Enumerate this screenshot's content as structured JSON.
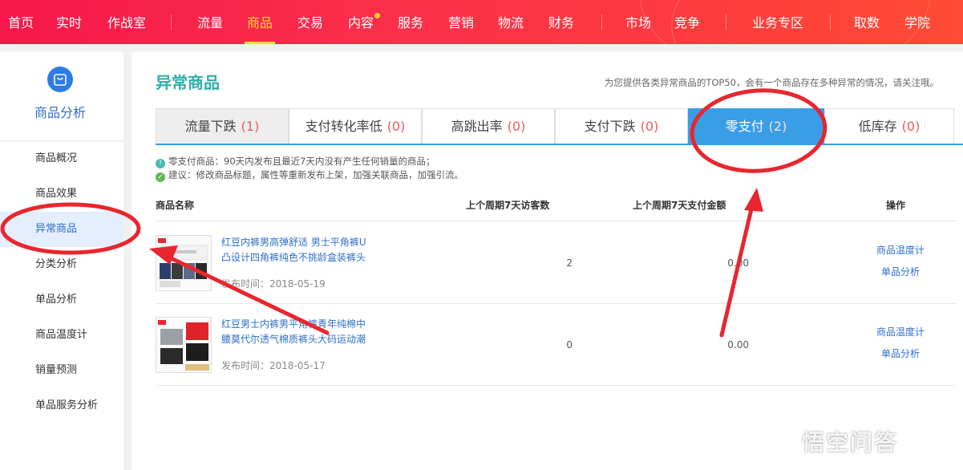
{
  "topnav": {
    "items": [
      "首页",
      "实时",
      "作战室",
      "流量",
      "商品",
      "交易",
      "内容",
      "服务",
      "营销",
      "物流",
      "财务",
      "市场",
      "竞争",
      "业务专区",
      "取数",
      "学院"
    ],
    "active": "商品",
    "accent": "#ffdf3a",
    "background": "#f5184a"
  },
  "sidebar": {
    "icon": "shopping-bag-icon",
    "title": "商品分析",
    "items": [
      "商品概况",
      "商品效果",
      "异常商品",
      "分类分析",
      "单品分析",
      "商品温度计",
      "销量预测",
      "单品服务分析"
    ],
    "active": "异常商品"
  },
  "main": {
    "title": "异常商品",
    "note": "为您提供各类异常商品的TOP50，会有一个商品存在多种异常的情况，请关注哦。",
    "tabs": [
      {
        "label": "流量下跌",
        "count": "(1)"
      },
      {
        "label": "支付转化率低",
        "count": "(0)"
      },
      {
        "label": "高跳出率",
        "count": "(0)"
      },
      {
        "label": "支付下跌",
        "count": "(0)"
      },
      {
        "label": "零支付",
        "count": "(2)"
      },
      {
        "label": "低库存",
        "count": "(0)"
      }
    ],
    "active_tab": "零支付",
    "tip_info": "零支付商品：90天内发布且最近7天内没有产生任何销量的商品；",
    "tip_suggest": "建议：修改商品标题，属性等重新发布上架，加强关联商品，加强引流。",
    "table": {
      "headers": [
        "商品名称",
        "上个周期7天访客数",
        "上个周期7天支付金额",
        "操作"
      ],
      "rows": [
        {
          "name": "红豆内裤男高弹舒适 男士平角裤U凸设计四角裤纯色不挑龄盒装裤头",
          "date": "发布时间：2018-05-19",
          "visitors": "2",
          "amount": "0.00",
          "actions": [
            "商品温度计",
            "单品分析"
          ]
        },
        {
          "name": "红豆男士内裤男平角裤青年纯棉中腰莫代尔透气棉质裤头大码运动潮",
          "date": "发布时间：2018-05-17",
          "visitors": "0",
          "amount": "0.00",
          "actions": [
            "商品温度计",
            "单品分析"
          ]
        }
      ]
    }
  },
  "watermark": "悟空问答",
  "annotation_color": "#e8262f"
}
